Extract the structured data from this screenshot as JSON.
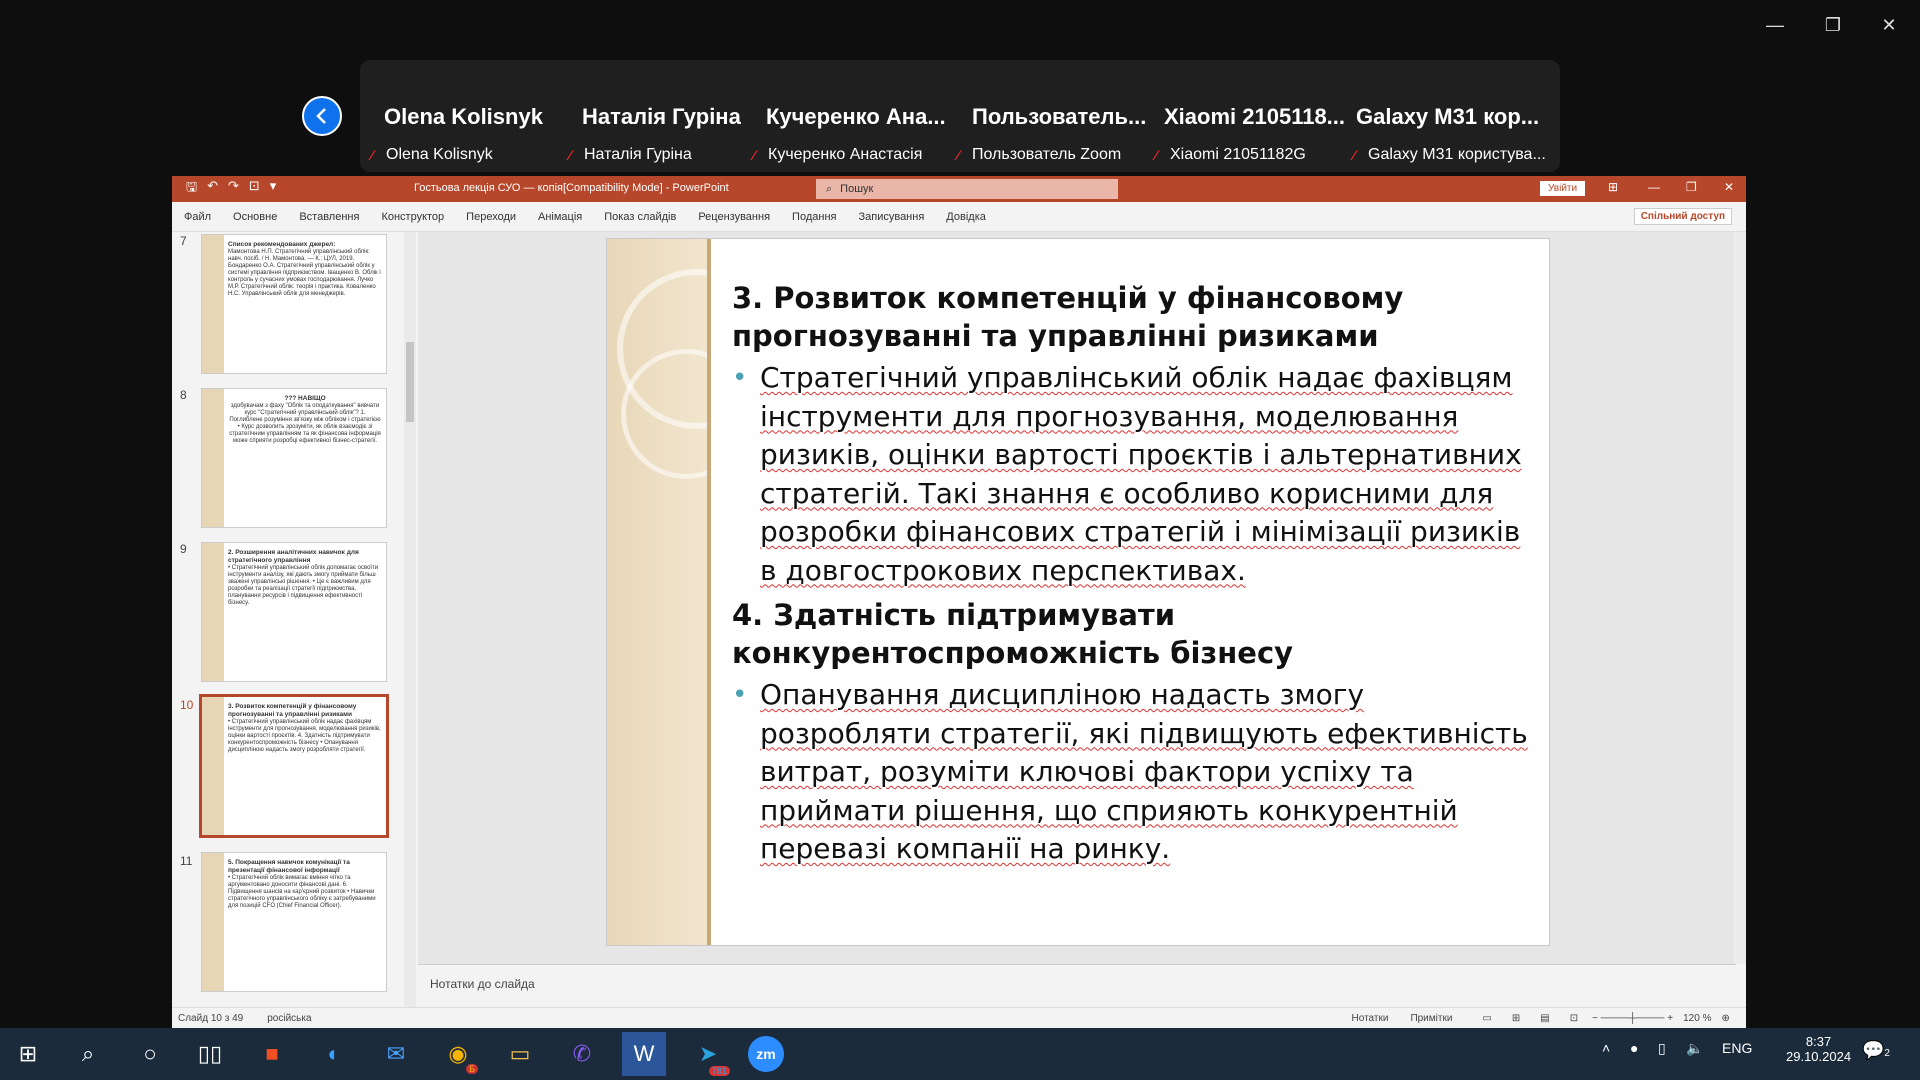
{
  "window_controls": {
    "minimize": "—",
    "restore": "❐",
    "close": "✕"
  },
  "zoom": {
    "participants": [
      {
        "display": "Olena Kolisnyk",
        "label": "Olena Kolisnyk"
      },
      {
        "display": "Наталія Гуріна",
        "label": "Наталія Гуріна"
      },
      {
        "display": "Кучеренко Ана...",
        "label": "Кучеренко Анастасія"
      },
      {
        "display": "Пользователь...",
        "label": "Пользователь Zoom"
      },
      {
        "display": "Xiaomi 2105118...",
        "label": "Xiaomi 21051182G"
      },
      {
        "display": "Galaxy M31 кор...",
        "label": "Galaxy M31 користува..."
      }
    ]
  },
  "ppt": {
    "title": "Гостьова лекція СУО — копія[Compatibility Mode] - PowerPoint",
    "search_placeholder": "Пошук",
    "signin": "Увійти",
    "share": "Спільний доступ",
    "tabs": [
      "Файл",
      "Основне",
      "Вставлення",
      "Конструктор",
      "Переходи",
      "Анімація",
      "Показ слайдів",
      "Рецензування",
      "Подання",
      "Записування",
      "Довідка"
    ],
    "thumbnails": [
      {
        "num": "7",
        "title": "Список рекомендованих джерел:",
        "body": "Мамонтова Н.П. Стратегічний управлінський облік: навч. посіб. / Н. Мамонтова. — К.: ЦУЛ, 2019. Бондаренко О.А. Стратегічний управлінський облік у системі управління підприємством. Іващенко В. Облік і контроль у сучасних умовах господарювання. Лучко М.Р. Стратегічний облік: теорія і практика. Коваленко Н.С. Управлінський облік для менеджерів."
      },
      {
        "num": "8",
        "title": "??? НАВІЩО",
        "body": "здобувачам з фаху \"Облік та оподаткування\" вивчати курс \"Стратегічний управлінський облік\"? 1. Поглиблене розуміння зв'язку між обліком і стратегією • Курс дозволить зрозуміти, як облік взаємодіє зі стратегічним управлінням та як фінансова інформація може сприяти розробці ефективної бізнес-стратегії."
      },
      {
        "num": "9",
        "title": "2. Розширення аналітичних навичок для стратегічного управління",
        "body": "• Стратегічний управлінський облік допомагає освоїти інструменти аналізу, які дають змогу приймати більш зважені управлінські рішення. • Це є важливим для розробки та реалізації стратегії підприємства, планування ресурсів і підвищення ефективності бізнесу."
      },
      {
        "num": "10",
        "title": "3. Розвиток компетенцій у фінансовому прогнозуванні та управлінні ризиками",
        "body": "• Стратегічний управлінський облік надає фахівцям інструменти для прогнозування, моделювання ризиків, оцінки вартості проєктів. 4. Здатність підтримувати конкурентоспроможність бізнесу • Опанування дисципліною надасть змогу розробляти стратегії."
      },
      {
        "num": "11",
        "title": "5. Покращення навичок комунікації та презентації фінансової інформації",
        "body": "• Стратегічний облік вимагає вміння чітко та аргументовано доносити фінансові дані. 6. Підвищення шансів на кар'єрний розвиток • Навички стратегічного управлінського обліку є затребуваними для позицій CFO (Chief Financial Officer)."
      }
    ],
    "slide": {
      "h1": "3. Розвиток компетенцій у фінансовому прогнозуванні та управлінні ризиками",
      "b1": "Стратегічний управлінський облік надає фахівцям інструменти для прогнозування, моделювання ризиків, оцінки вартості проєктів і альтернативних стратегій. Такі знання є особливо корисними для розробки фінансових стратегій і мінімізації ризиків в довгострокових перспективах.",
      "h2": "4. Здатність підтримувати конкурентоспроможність бізнесу",
      "b2": "Опанування дисципліною надасть змогу розробляти стратегії, які підвищують ефективність витрат, розуміти ключові фактори успіху та приймати рішення, що сприяють конкурентній перевазі компанії на ринку."
    },
    "notes_placeholder": "Нотатки до слайда",
    "status": {
      "slide": "Слайд 10 з 49",
      "lang": "російська",
      "notes": "Нотатки",
      "comments": "Примітки",
      "zoom": "120 %"
    }
  },
  "taskbar": {
    "lang": "ENG",
    "time": "8:37",
    "date": "29.10.2024",
    "telegram_badge": "781",
    "chrome_badge": "Б",
    "notif_count": "2",
    "accent": "#b7472a"
  }
}
